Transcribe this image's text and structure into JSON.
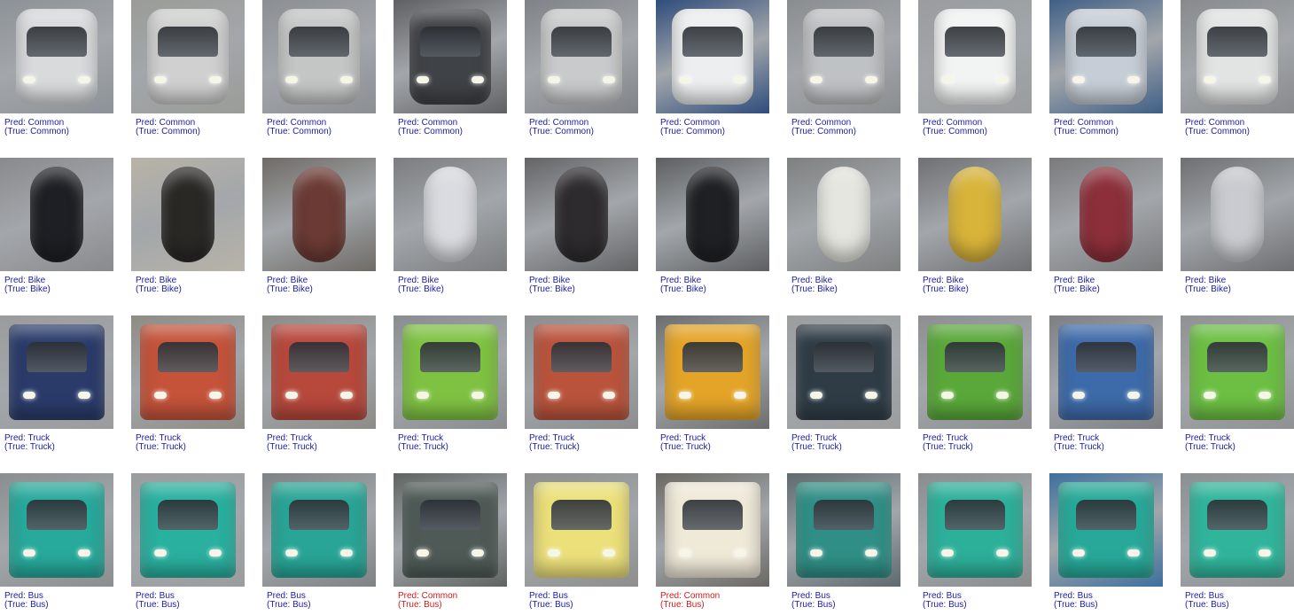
{
  "colors": {
    "correct_label": "#1a1aa6",
    "wrong_label": "#d21a1a"
  },
  "rows": [
    {
      "class": "Common",
      "items": [
        {
          "pred": "Pred: Common",
          "true": "(True: Common)",
          "correct": true,
          "body": "#d9dadc",
          "bg": "#8d9298"
        },
        {
          "pred": "Pred: Common",
          "true": "(True: Common)",
          "correct": true,
          "body": "#cfd0cf",
          "bg": "#9b9c98"
        },
        {
          "pred": "Pred: Common",
          "true": "(True: Common)",
          "correct": true,
          "body": "#c4c6c6",
          "bg": "#8b8f93"
        },
        {
          "pred": "Pred: Common",
          "true": "(True: Common)",
          "correct": true,
          "body": "#3f4246",
          "bg": "#5f6063"
        },
        {
          "pred": "Pred: Common",
          "true": "(True: Common)",
          "correct": true,
          "body": "#c9cacb",
          "bg": "#7f8286"
        },
        {
          "pred": "Pred: Common",
          "true": "(True: Common)",
          "correct": true,
          "body": "#eceeef",
          "bg": "#2f4c7c"
        },
        {
          "pred": "Pred: Common",
          "true": "(True: Common)",
          "correct": true,
          "body": "#bfc2c4",
          "bg": "#8a8d90"
        },
        {
          "pred": "Pred: Common",
          "true": "(True: Common)",
          "correct": true,
          "body": "#f2f3f3",
          "bg": "#9a9c9e"
        },
        {
          "pred": "Pred: Common",
          "true": "(True: Common)",
          "correct": true,
          "body": "#c6cdd6",
          "bg": "#3f5f86"
        },
        {
          "pred": "Pred: Common",
          "true": "(True: Common)",
          "correct": true,
          "body": "#e2e3e3",
          "bg": "#888a8c"
        }
      ]
    },
    {
      "class": "Bike",
      "items": [
        {
          "pred": "Pred: Bike",
          "true": "(True: Bike)",
          "correct": true,
          "body": "#1e1f24",
          "bg": "#8a8a8e"
        },
        {
          "pred": "Pred: Bike",
          "true": "(True: Bike)",
          "correct": true,
          "body": "#2a2825",
          "bg": "#b8b3a8"
        },
        {
          "pred": "Pred: Bike",
          "true": "(True: Bike)",
          "correct": true,
          "body": "#6b3a34",
          "bg": "#6f6b66"
        },
        {
          "pred": "Pred: Bike",
          "true": "(True: Bike)",
          "correct": true,
          "body": "#d9dbe0",
          "bg": "#7b7d80"
        },
        {
          "pred": "Pred: Bike",
          "true": "(True: Bike)",
          "correct": true,
          "body": "#2d2b2d",
          "bg": "#646466"
        },
        {
          "pred": "Pred: Bike",
          "true": "(True: Bike)",
          "correct": true,
          "body": "#1f2023",
          "bg": "#5d5f62"
        },
        {
          "pred": "Pred: Bike",
          "true": "(True: Bike)",
          "correct": true,
          "body": "#e6e6e0",
          "bg": "#7e8080"
        },
        {
          "pred": "Pred: Bike",
          "true": "(True: Bike)",
          "correct": true,
          "body": "#d9b43a",
          "bg": "#6f7073"
        },
        {
          "pred": "Pred: Bike",
          "true": "(True: Bike)",
          "correct": true,
          "body": "#8c2f3a",
          "bg": "#7a7a7c"
        },
        {
          "pred": "Pred: Bike",
          "true": "(True: Bike)",
          "correct": true,
          "body": "#c9cbd0",
          "bg": "#6e6f72"
        }
      ]
    },
    {
      "class": "Truck",
      "items": [
        {
          "pred": "Pred: Truck",
          "true": "(True: Truck)",
          "correct": true,
          "body": "#2a3b6a",
          "bg": "#9a9b9c"
        },
        {
          "pred": "Pred: Truck",
          "true": "(True: Truck)",
          "correct": true,
          "body": "#c4533a",
          "bg": "#8e8b84"
        },
        {
          "pred": "Pred: Truck",
          "true": "(True: Truck)",
          "correct": true,
          "body": "#b7483c",
          "bg": "#8d8b87"
        },
        {
          "pred": "Pred: Truck",
          "true": "(True: Truck)",
          "correct": true,
          "body": "#7fc242",
          "bg": "#8a8d8f"
        },
        {
          "pred": "Pred: Truck",
          "true": "(True: Truck)",
          "correct": true,
          "body": "#b9533c",
          "bg": "#8b8d8e"
        },
        {
          "pred": "Pred: Truck",
          "true": "(True: Truck)",
          "correct": true,
          "body": "#e3a428",
          "bg": "#6c6d6e"
        },
        {
          "pred": "Pred: Truck",
          "true": "(True: Truck)",
          "correct": true,
          "body": "#2f3c46",
          "bg": "#9c9d9e"
        },
        {
          "pred": "Pred: Truck",
          "true": "(True: Truck)",
          "correct": true,
          "body": "#5aa83a",
          "bg": "#8c8e90"
        },
        {
          "pred": "Pred: Truck",
          "true": "(True: Truck)",
          "correct": true,
          "body": "#3d6aa8",
          "bg": "#7d7f82"
        },
        {
          "pred": "Pred: Truck",
          "true": "(True: Truck)",
          "correct": true,
          "body": "#6cbf43",
          "bg": "#8f9193"
        }
      ]
    },
    {
      "class": "Bus",
      "items": [
        {
          "pred": "Pred: Bus",
          "true": "(True: Bus)",
          "correct": true,
          "body": "#27a99b",
          "bg": "#8b8e8f"
        },
        {
          "pred": "Pred: Bus",
          "true": "(True: Bus)",
          "correct": true,
          "body": "#29b09f",
          "bg": "#9a9c9d"
        },
        {
          "pred": "Pred: Bus",
          "true": "(True: Bus)",
          "correct": true,
          "body": "#28a596",
          "bg": "#7f8284"
        },
        {
          "pred": "Pred: Common",
          "true": "(True: Bus)",
          "correct": false,
          "body": "#4f5a57",
          "bg": "#5f6361"
        },
        {
          "pred": "Pred: Bus",
          "true": "(True: Bus)",
          "correct": true,
          "body": "#ece07a",
          "bg": "#8d8e8c"
        },
        {
          "pred": "Pred: Common",
          "true": "(True: Bus)",
          "correct": false,
          "body": "#efe9d8",
          "bg": "#6a6863"
        },
        {
          "pred": "Pred: Bus",
          "true": "(True: Bus)",
          "correct": true,
          "body": "#2f8f86",
          "bg": "#5d6a6e"
        },
        {
          "pred": "Pred: Bus",
          "true": "(True: Bus)",
          "correct": true,
          "body": "#2db09a",
          "bg": "#8a8c8e"
        },
        {
          "pred": "Pred: Bus",
          "true": "(True: Bus)",
          "correct": true,
          "body": "#27a898",
          "bg": "#3d6f9e"
        },
        {
          "pred": "Pred: Bus",
          "true": "(True: Bus)",
          "correct": true,
          "body": "#30b59c",
          "bg": "#8c8f92"
        }
      ]
    }
  ]
}
